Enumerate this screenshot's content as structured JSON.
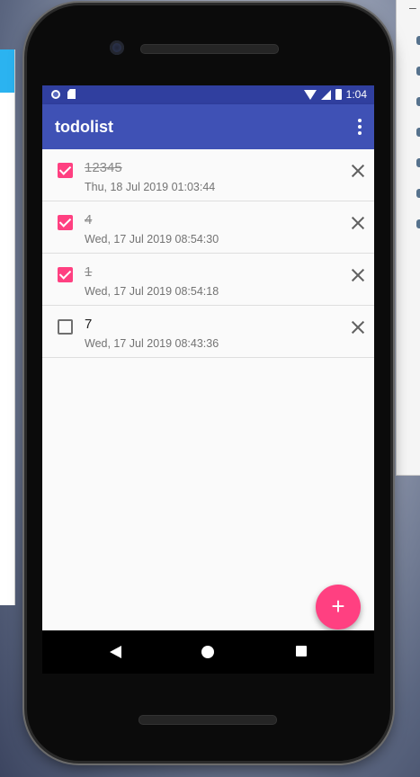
{
  "status_bar": {
    "time": "1:04"
  },
  "app_bar": {
    "title": "todolist"
  },
  "todos": [
    {
      "title": "12345",
      "timestamp": "Thu, 18 Jul 2019 01:03:44",
      "done": true
    },
    {
      "title": "4",
      "timestamp": "Wed, 17 Jul 2019 08:54:30",
      "done": true
    },
    {
      "title": "1",
      "timestamp": "Wed, 17 Jul 2019 08:54:18",
      "done": true
    },
    {
      "title": "7",
      "timestamp": "Wed, 17 Jul 2019 08:43:36",
      "done": false
    }
  ],
  "fab": {
    "label": "+"
  },
  "colors": {
    "primary": "#3f51b5",
    "primary_dark": "#303f9f",
    "accent": "#ff4081"
  },
  "icons": [
    "notification-circle-icon",
    "sd-card-icon",
    "wifi-icon",
    "signal-icon",
    "battery-icon",
    "overflow-menu-icon",
    "close-icon",
    "add-icon",
    "back-icon",
    "home-icon",
    "recents-icon"
  ]
}
